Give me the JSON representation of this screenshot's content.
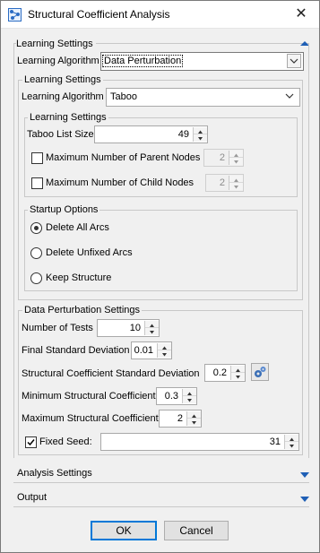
{
  "window": {
    "title": "Structural Coefficient Analysis",
    "close": "✕"
  },
  "learning_settings": {
    "title": "Learning Settings",
    "algorithm_label": "Learning Algorithm",
    "algorithm_value": "Data Perturbation",
    "inner": {
      "title": "Learning Settings",
      "algorithm_label": "Learning Algorithm",
      "algorithm_value": "Taboo",
      "inner": {
        "title": "Learning Settings",
        "taboo_label": "Taboo List Size",
        "taboo_value": "49",
        "max_parents_label": "Maximum Number of Parent Nodes",
        "max_parents_value": "2",
        "max_children_label": "Maximum Number of Child Nodes",
        "max_children_value": "2"
      },
      "startup": {
        "title": "Startup Options",
        "opt1": "Delete All Arcs",
        "opt2": "Delete Unfixed Arcs",
        "opt3": "Keep Structure"
      }
    },
    "perturbation": {
      "title": "Data Perturbation Settings",
      "tests_label": "Number of Tests",
      "tests_value": "10",
      "final_std_label": "Final Standard Deviation",
      "final_std_value": "0.01",
      "coef_std_label": "Structural Coefficient Standard Deviation",
      "coef_std_value": "0.2",
      "min_coef_label": "Minimum Structural Coefficient",
      "min_coef_value": "0.3",
      "max_coef_label": "Maximum Structural Coefficient",
      "max_coef_value": "2",
      "fixed_seed_label": "Fixed Seed:",
      "fixed_seed_value": "31"
    }
  },
  "analysis_settings": {
    "title": "Analysis Settings"
  },
  "output": {
    "title": "Output"
  },
  "buttons": {
    "ok": "OK",
    "cancel": "Cancel"
  },
  "colors": {
    "accent": "#0078d7",
    "link_blue": "#1f5fb5"
  }
}
